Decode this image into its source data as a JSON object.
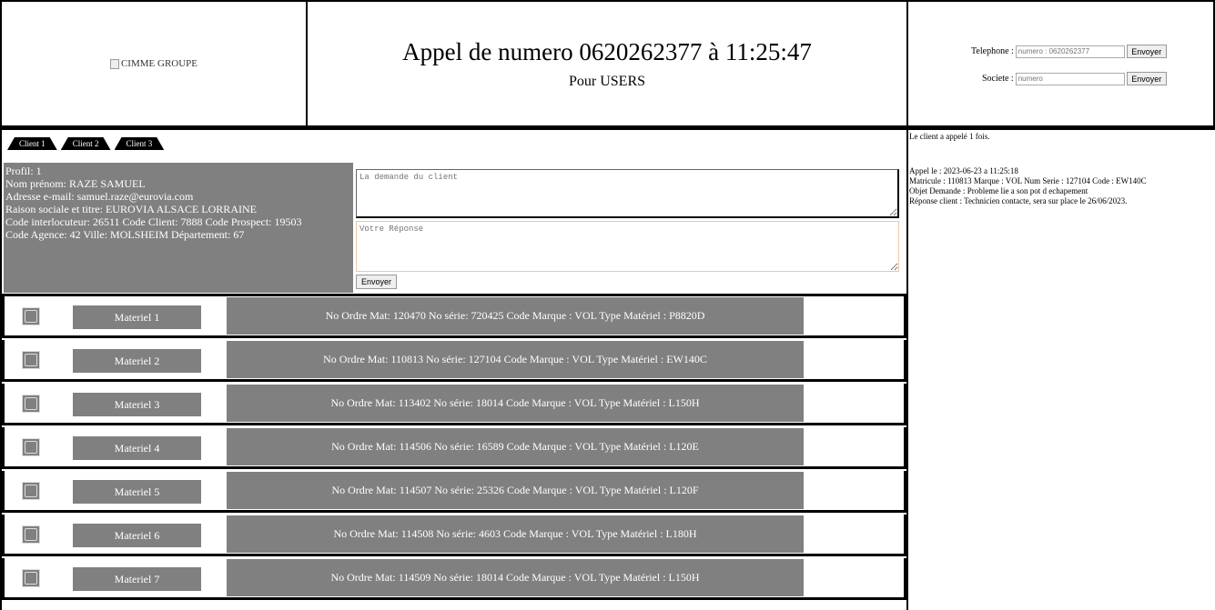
{
  "header": {
    "logo_alt": "CIMME GROUPE",
    "call_title": "Appel de numero 0620262377 à 11:25:47",
    "call_subtitle": "Pour USERS"
  },
  "search": {
    "phone_label": "Telephone :",
    "phone_placeholder": "numero : 0620262377",
    "phone_button": "Envoyer",
    "company_label": "Societe :",
    "company_placeholder": "numero",
    "company_button": "Envoyer"
  },
  "tabs": [
    "Client 1",
    "Client 2",
    "Client 3"
  ],
  "client": {
    "profile": "Profil: 1",
    "name": "Nom prénom: RAZE SAMUEL",
    "email": "Adresse e-mail: samuel.raze@eurovia.com",
    "company": "Raison sociale et titre: EUROVIA ALSACE LORRAINE",
    "codes": "Code interlocuteur: 26511 Code Client: 7888 Code Prospect: 19503",
    "agency": "Code Agence: 42 Ville: MOLSHEIM Département: 67"
  },
  "form": {
    "demand_placeholder": "La demande du client",
    "reply_placeholder": "Votre Réponse",
    "send_button": "Envoyer"
  },
  "materials": [
    {
      "name": "Materiel 1",
      "desc": "No Ordre Mat: 120470 No série: 720425 Code Marque : VOL Type Matériel : P8820D"
    },
    {
      "name": "Materiel 2",
      "desc": "No Ordre Mat: 110813 No série: 127104 Code Marque : VOL Type Matériel : EW140C"
    },
    {
      "name": "Materiel 3",
      "desc": "No Ordre Mat: 113402 No série: 18014 Code Marque : VOL Type Matériel : L150H"
    },
    {
      "name": "Materiel 4",
      "desc": "No Ordre Mat: 114506 No série: 16589 Code Marque : VOL Type Matériel : L120E"
    },
    {
      "name": "Materiel 5",
      "desc": "No Ordre Mat: 114507 No série: 25326 Code Marque : VOL Type Matériel : L120F"
    },
    {
      "name": "Materiel 6",
      "desc": "No Ordre Mat: 114508 No série: 4603 Code Marque : VOL Type Matériel : L180H"
    },
    {
      "name": "Materiel 7",
      "desc": "No Ordre Mat: 114509 No série: 18014 Code Marque : VOL Type Matériel : L150H"
    }
  ],
  "history": {
    "count_text": "Le client a appelé 1 fois.",
    "call_date": "Appel le : 2023-06-23 a 11:25:18",
    "matricule": "Matricule : 110813 Marque : VOL Num Serie : 127104 Code : EW140C",
    "objet": "Objet Demande : Probleme lie a son pot d echapement",
    "reponse": "Réponse client : Technicien contacte, sera sur place le 26/06/2023."
  }
}
